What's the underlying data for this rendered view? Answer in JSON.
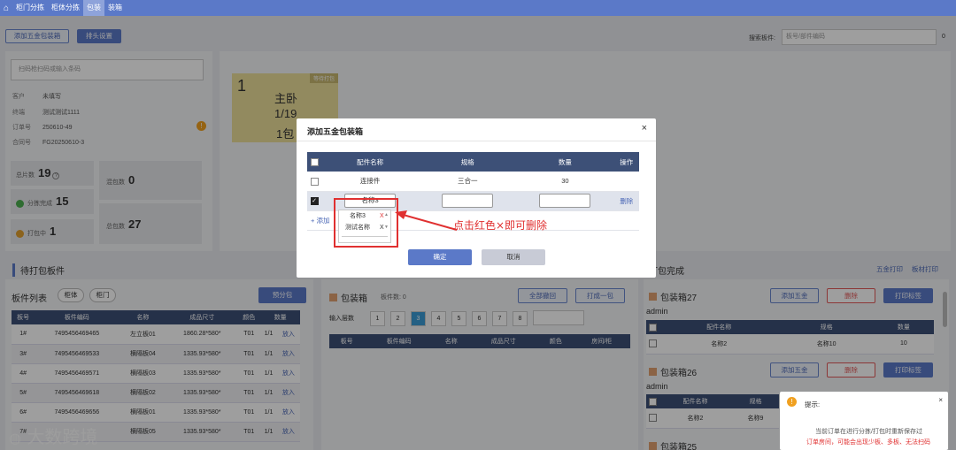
{
  "topnav": {
    "tabs": [
      "柜门分拣",
      "柜体分拣",
      "包装",
      "装箱"
    ]
  },
  "toolbar": {
    "add_hardware_box": "添加五金包装箱",
    "sort_setting": "排头设置",
    "search_label": "搜索板件:",
    "search_placeholder": "板号/部件编码",
    "search_count": "0"
  },
  "order": {
    "scan_placeholder": "扫码枪扫码或输入条码",
    "rows": [
      {
        "k": "客户",
        "v": "未填写"
      },
      {
        "k": "终端",
        "v": "测试测试1111"
      },
      {
        "k": "订单号",
        "v": "250610-49"
      },
      {
        "k": "合同号",
        "v": "FG20250610-3"
      }
    ]
  },
  "stats": {
    "total_label": "总片数",
    "total": "19",
    "mixed_label": "混包数",
    "mixed": "0",
    "sorted_label": "分拣完成",
    "sorted": "15",
    "packed_label": "总包数",
    "packed": "27",
    "packing_label": "打包中",
    "packing": "1"
  },
  "card": {
    "num": "1",
    "badge": "等待打包",
    "room": "主卧",
    "frac": "1/19",
    "pkgs": "1包"
  },
  "pending": {
    "title": "待打包板件",
    "list_title": "板件列表",
    "filter1": "柜体",
    "filter2": "柜门",
    "pre_pack": "预分包",
    "headers": [
      "板号",
      "板件编码",
      "名称",
      "成品尺寸",
      "颜色",
      "数量"
    ],
    "rows": [
      [
        "1#",
        "7495456469465",
        "左立板01",
        "1860.28*580*",
        "T01",
        "1/1",
        "放入"
      ],
      [
        "3#",
        "7495456469533",
        "横隔板04",
        "1335.93*580*",
        "T01",
        "1/1",
        "放入"
      ],
      [
        "4#",
        "7495456469571",
        "横隔板03",
        "1335.93*580*",
        "T01",
        "1/1",
        "放入"
      ],
      [
        "5#",
        "7495456469618",
        "横隔板02",
        "1335.93*580*",
        "T01",
        "1/1",
        "放入"
      ],
      [
        "6#",
        "7495456469656",
        "横隔板01",
        "1335.93*580*",
        "T01",
        "1/1",
        "放入"
      ],
      [
        "7#",
        "",
        "横隔板05",
        "1335.93*580*",
        "T01",
        "1/1",
        "放入"
      ]
    ]
  },
  "box": {
    "title": "包装箱",
    "count_label": "板件数: 0",
    "recall_all": "全部撤回",
    "pack_one": "打成一包",
    "layers_label": "输入层数",
    "pages": [
      "1",
      "2",
      "3",
      "4",
      "5",
      "6",
      "7",
      "8"
    ],
    "headers": [
      "板号",
      "板件编码",
      "名称",
      "成品尺寸",
      "颜色",
      "房间/柜"
    ]
  },
  "done": {
    "title": "打包完成",
    "hardware_print": "五金打印",
    "board_print": "板材打印",
    "boxes": [
      {
        "name": "包装箱27",
        "user": "admin",
        "add": "添加五金",
        "del": "删除",
        "print": "打印标签",
        "headers": [
          "配件名称",
          "规格",
          "数量"
        ],
        "row": [
          "名称2",
          "名称10",
          "10"
        ]
      },
      {
        "name": "包装箱26",
        "user": "admin",
        "add": "添加五金",
        "del": "删除",
        "print": "打印标签",
        "headers": [
          "配件名称",
          "规格",
          "数量"
        ],
        "row": [
          "名称2",
          "名称9",
          ""
        ]
      },
      {
        "name": "包装箱25",
        "user": "",
        "add": "",
        "del": "",
        "print": "",
        "headers": [],
        "row": []
      }
    ]
  },
  "modal": {
    "title": "添加五金包装箱",
    "headers": [
      "配件名称",
      "规格",
      "数量",
      "操作"
    ],
    "row1": [
      "连接件",
      "三合一",
      "30"
    ],
    "row2_input": "名称3",
    "delete": "删除",
    "add_link": "+ 添加",
    "confirm": "确定",
    "cancel": "取消"
  },
  "dropdown": {
    "items": [
      {
        "label": "名称3",
        "x": "X"
      },
      {
        "label": "测试名称",
        "x": "X"
      }
    ]
  },
  "annotation": "点击红色×即可删除",
  "tip": {
    "title": "提示:",
    "line1": "当前订单在进行分拣/打包时重新保存过",
    "line2": "订单房间，可能会出现少板、多板、无法扫码"
  },
  "watermark": "大数跨境",
  "colors": {
    "nav": "#5b79c8",
    "header": "#3d5077",
    "danger": "#e03030",
    "card": "#ecdf9a"
  }
}
